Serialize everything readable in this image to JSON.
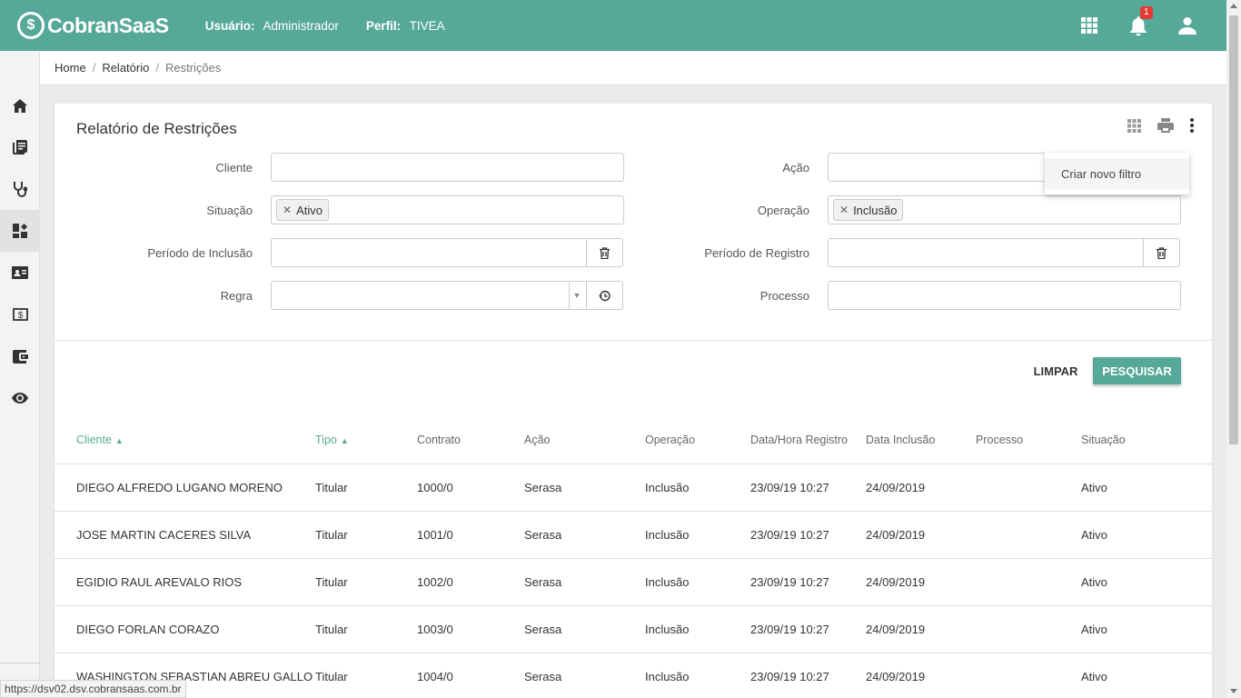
{
  "header": {
    "logo_symbol": "$",
    "logo_text": "CobranSaaS",
    "user_label": "Usuário:",
    "user_value": "Administrador",
    "profile_label": "Perfil:",
    "profile_value": "TIVEA",
    "notification_count": "1",
    "icons": [
      "apps-grid-icon",
      "bell-icon",
      "user-icon"
    ]
  },
  "sidebar": {
    "items": [
      {
        "icon": "home-icon"
      },
      {
        "icon": "library-icon"
      },
      {
        "icon": "stethoscope-icon"
      },
      {
        "icon": "dashboard-icon",
        "active": true
      },
      {
        "icon": "contact-card-icon"
      },
      {
        "icon": "money-icon"
      },
      {
        "icon": "wallet-icon"
      },
      {
        "icon": "eye-icon"
      }
    ]
  },
  "breadcrumb": {
    "items": [
      "Home",
      "Relatório"
    ],
    "current": "Restrições"
  },
  "card": {
    "title": "Relatório de Restrições",
    "tools": [
      "grid-icon",
      "print-icon",
      "more-vertical-icon"
    ]
  },
  "filters": {
    "cliente": {
      "label": "Cliente",
      "value": ""
    },
    "situacao": {
      "label": "Situação",
      "chip": "Ativo"
    },
    "periodo_inclusao": {
      "label": "Período de Inclusão",
      "value": ""
    },
    "regra": {
      "label": "Regra",
      "value": ""
    },
    "acao": {
      "label": "Ação",
      "value": ""
    },
    "operacao": {
      "label": "Operação",
      "chip": "Inclusão"
    },
    "periodo_registro": {
      "label": "Período de Registro",
      "value": ""
    },
    "processo": {
      "label": "Processo",
      "value": ""
    }
  },
  "buttons": {
    "clear": "LIMPAR",
    "search": "PESQUISAR"
  },
  "menu": {
    "items": [
      "Criar novo filtro"
    ]
  },
  "table": {
    "columns": [
      "Cliente",
      "Tipo",
      "Contrato",
      "Ação",
      "Operação",
      "Data/Hora Registro",
      "Data Inclusão",
      "Processo",
      "Situação"
    ],
    "rows": [
      [
        "DIEGO ALFREDO LUGANO MORENO",
        "Titular",
        "1000/0",
        "Serasa",
        "Inclusão",
        "23/09/19 10:27",
        "24/09/2019",
        "",
        "Ativo"
      ],
      [
        "JOSE MARTIN CACERES SILVA",
        "Titular",
        "1001/0",
        "Serasa",
        "Inclusão",
        "23/09/19 10:27",
        "24/09/2019",
        "",
        "Ativo"
      ],
      [
        "EGIDIO RAUL AREVALO RIOS",
        "Titular",
        "1002/0",
        "Serasa",
        "Inclusão",
        "23/09/19 10:27",
        "24/09/2019",
        "",
        "Ativo"
      ],
      [
        "DIEGO FORLAN CORAZO",
        "Titular",
        "1003/0",
        "Serasa",
        "Inclusão",
        "23/09/19 10:27",
        "24/09/2019",
        "",
        "Ativo"
      ],
      [
        "WASHINGTON SEBASTIAN ABREU GALLO",
        "Titular",
        "1004/0",
        "Serasa",
        "Inclusão",
        "23/09/19 10:27",
        "24/09/2019",
        "",
        "Ativo"
      ]
    ]
  },
  "statusbar": {
    "url": "https://dsv02.dsv.cobransaas.com.br"
  },
  "colors": {
    "primary": "#56a899",
    "badge": "#e53935"
  }
}
